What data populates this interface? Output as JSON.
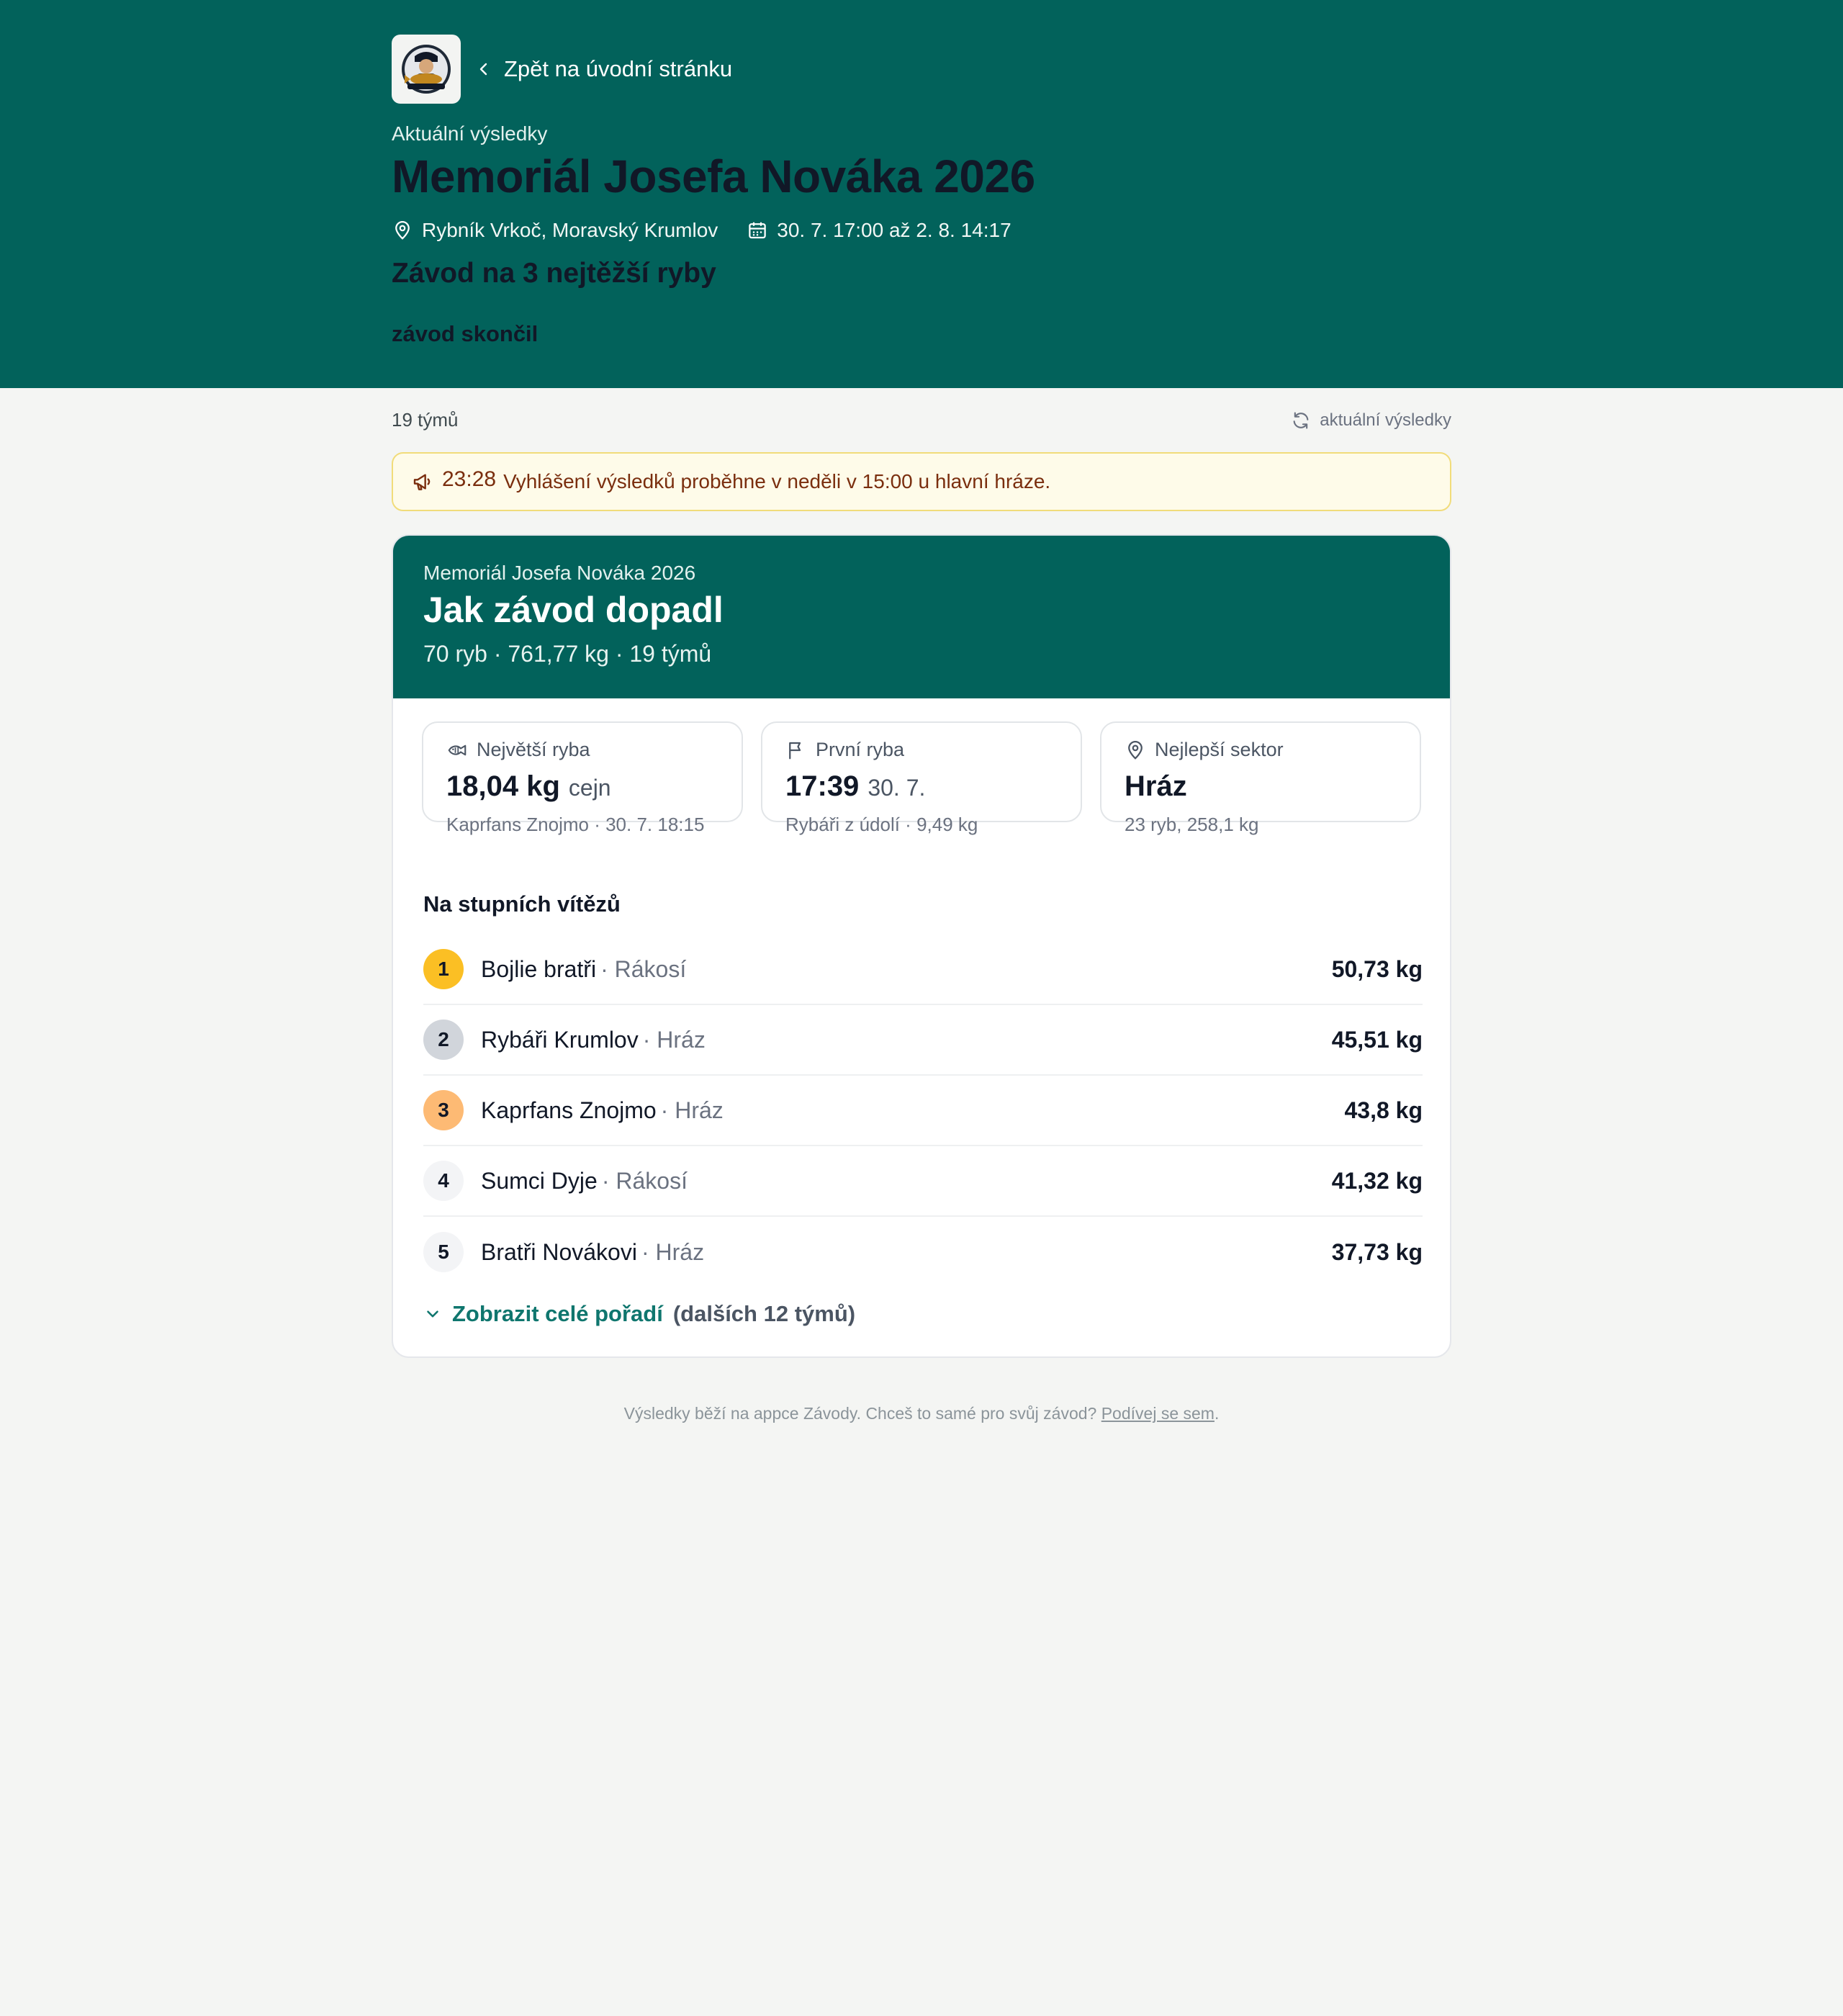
{
  "header": {
    "back_label": "Zpět na úvodní stránku",
    "kicker": "Aktuální výsledky",
    "title": "Memoriál Josefa Nováka 2026",
    "location": "Rybník Vrkoč, Moravský Krumlov",
    "dates": "30. 7. 17:00 až 2. 8. 14:17",
    "subtitle": "Závod na 3 nejtěžší ryby",
    "status": "závod skončil"
  },
  "summary": {
    "team_count": "19 týmů",
    "refresh_label": "aktuální výsledky"
  },
  "announcement": {
    "time": "23:28",
    "text": "Vyhlášení výsledků proběhne v neděli v 15:00 u hlavní hráze."
  },
  "results_card": {
    "kicker": "Memoriál Josefa Nováka 2026",
    "title": "Jak závod dopadl",
    "stats": "70 ryb · 761,77 kg · 19 týmů"
  },
  "stats": [
    {
      "label": "Největší ryba",
      "value": "18,04 kg",
      "unit": "cejn",
      "foot": "Kaprfans Znojmo · 30. 7. 18:15"
    },
    {
      "label": "První ryba",
      "value": "17:39",
      "unit": "30. 7.",
      "foot": "Rybáři z údolí · 9,49 kg"
    },
    {
      "label": "Nejlepší sektor",
      "value": "Hráz",
      "unit": "",
      "foot": "23 ryb, 258,1 kg"
    }
  ],
  "podium": {
    "title": "Na stupních vítězů",
    "rows": [
      {
        "rank": "1",
        "team": "Bojlie bratři",
        "sector": "· Rákosí",
        "weight": "50,73 kg"
      },
      {
        "rank": "2",
        "team": "Rybáři Krumlov",
        "sector": "· Hráz",
        "weight": "45,51 kg"
      },
      {
        "rank": "3",
        "team": "Kaprfans Znojmo",
        "sector": "· Hráz",
        "weight": "43,8 kg"
      },
      {
        "rank": "4",
        "team": "Sumci Dyje",
        "sector": "· Rákosí",
        "weight": "41,32 kg"
      },
      {
        "rank": "5",
        "team": "Bratři Novákovi",
        "sector": "· Hráz",
        "weight": "37,73 kg"
      }
    ],
    "show_all_label": "Zobrazit celé pořadí",
    "show_all_rest": "(dalších 12 týmů)"
  },
  "footer": {
    "text": "Výsledky běží na appce Závody. Chceš to samé pro svůj závod?",
    "link": "Podívej se sem",
    "end": "."
  },
  "colors": {
    "brand": "#02625b",
    "gold": "#fbbf24",
    "silver": "#d1d5db",
    "bronze": "#fdba74",
    "notice_bg": "#fefbe9"
  }
}
